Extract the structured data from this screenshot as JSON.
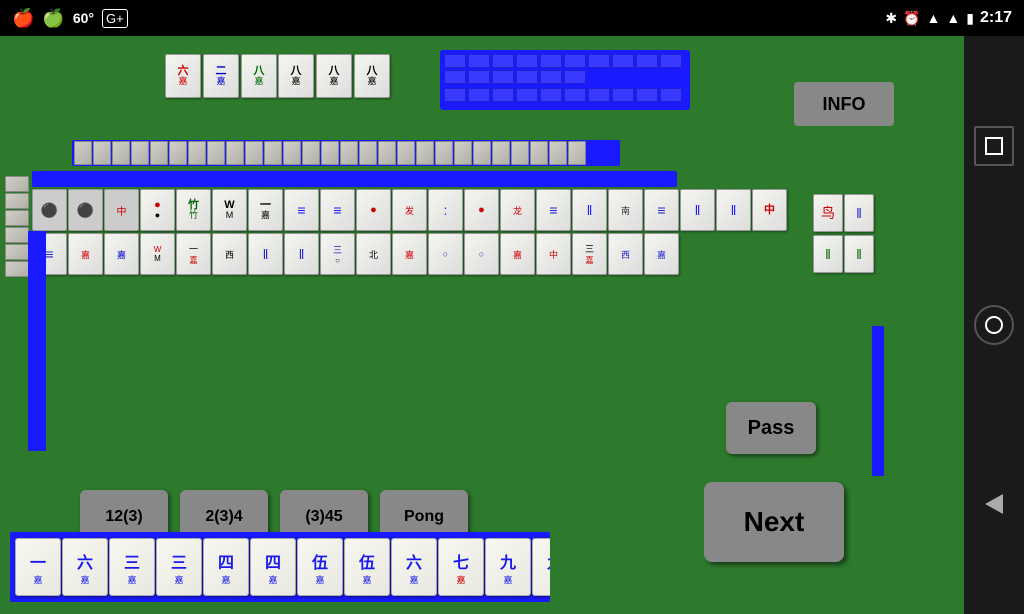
{
  "statusBar": {
    "appleIcon1": "🍎",
    "appleIcon2": "🍏",
    "temperature": "60°",
    "gplusIcon": "G+",
    "bluetoothIcon": "⚡",
    "alarmIcon": "⏰",
    "wifiIcon": "▲",
    "signalIcon": "▲",
    "batteryIcon": "🔋",
    "time": "2:17"
  },
  "buttons": {
    "info": "INFO",
    "action1": "12(3)",
    "action2": "2(3)4",
    "action3": "(3)45",
    "action4": "Pong",
    "pass": "Pass",
    "next": "Next"
  },
  "handTiles": [
    "一",
    "六",
    "三",
    "三",
    "四",
    "四",
    "伍",
    "伍",
    "六",
    "七",
    "九",
    "九"
  ],
  "colors": {
    "gameBackground": "#2d7a2d",
    "tileBackground": "#f5f5f0",
    "blueAccent": "#1a1aff",
    "buttonGray": "#888888"
  }
}
